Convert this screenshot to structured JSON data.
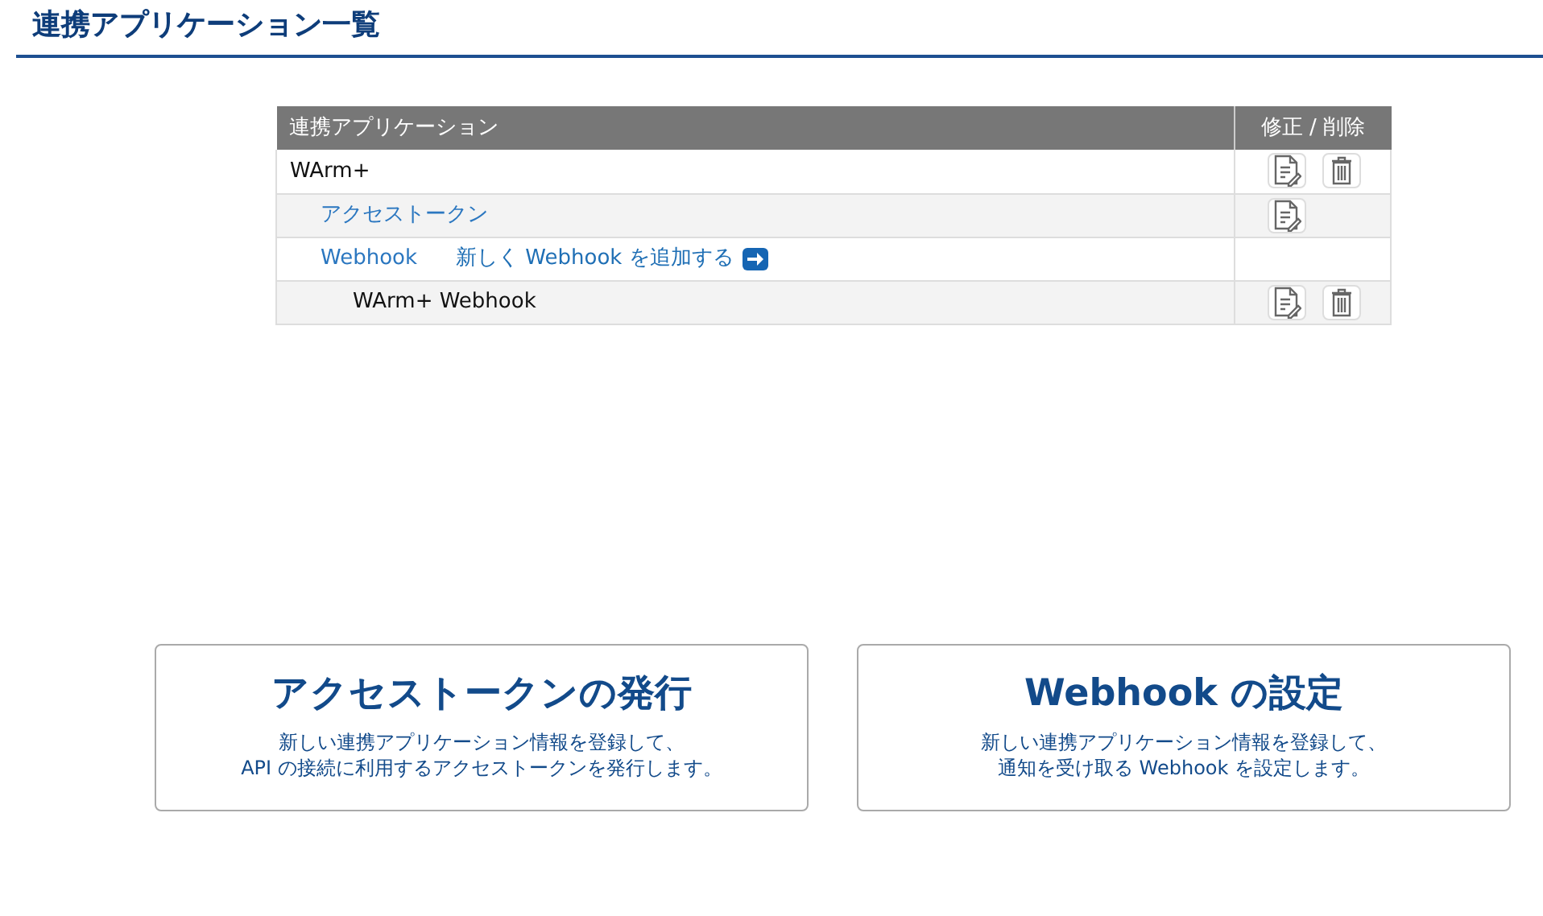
{
  "page_title": "連携アプリケーション一覧",
  "table": {
    "columns": [
      "連携アプリケーション",
      "修正 / 削除"
    ],
    "rows": [
      {
        "kind": "app",
        "label": "WArm+",
        "editable": true,
        "deletable": true,
        "children": [
          {
            "kind": "link",
            "label": "アクセストークン",
            "editable": true,
            "deletable": false
          },
          {
            "kind": "link",
            "label": "Webhook",
            "add_link": "新しく Webhook を追加する",
            "editable": false,
            "deletable": false,
            "children": [
              {
                "kind": "item",
                "label": "WArm+ Webhook",
                "editable": true,
                "deletable": true
              }
            ]
          }
        ]
      }
    ]
  },
  "cards": [
    {
      "title": "アクセストークンの発行",
      "description_lines": [
        "新しい連携アプリケーション情報を登録して、",
        "API の接続に利用するアクセストークンを発行します。"
      ]
    },
    {
      "title": "Webhook の設定",
      "description_lines": [
        "新しい連携アプリケーション情報を登録して、",
        "通知を受け取る Webhook を設定します。"
      ]
    }
  ]
}
